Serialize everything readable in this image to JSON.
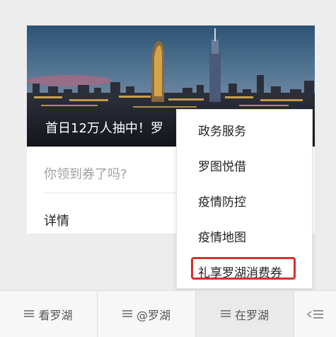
{
  "article": {
    "cover_title": "首日12万人抽中！罗",
    "digest": "你领到券了吗?",
    "details_label": "详情"
  },
  "popup_menu": {
    "items": [
      {
        "label": "政务服务"
      },
      {
        "label": "罗图悦借"
      },
      {
        "label": "疫情防控"
      },
      {
        "label": "疫情地图"
      },
      {
        "label": "礼享罗湖消费券"
      }
    ],
    "highlighted_index": 4,
    "highlight_color": "#d9302c"
  },
  "bottom_menu": {
    "tabs": [
      {
        "label": "看罗湖",
        "icon": "menu-lines-icon"
      },
      {
        "label": "@罗湖",
        "icon": "menu-lines-icon"
      },
      {
        "label": "在罗湖",
        "icon": "menu-lines-icon",
        "active": true
      }
    ],
    "toggle_icon": "keyboard-collapse-icon"
  }
}
